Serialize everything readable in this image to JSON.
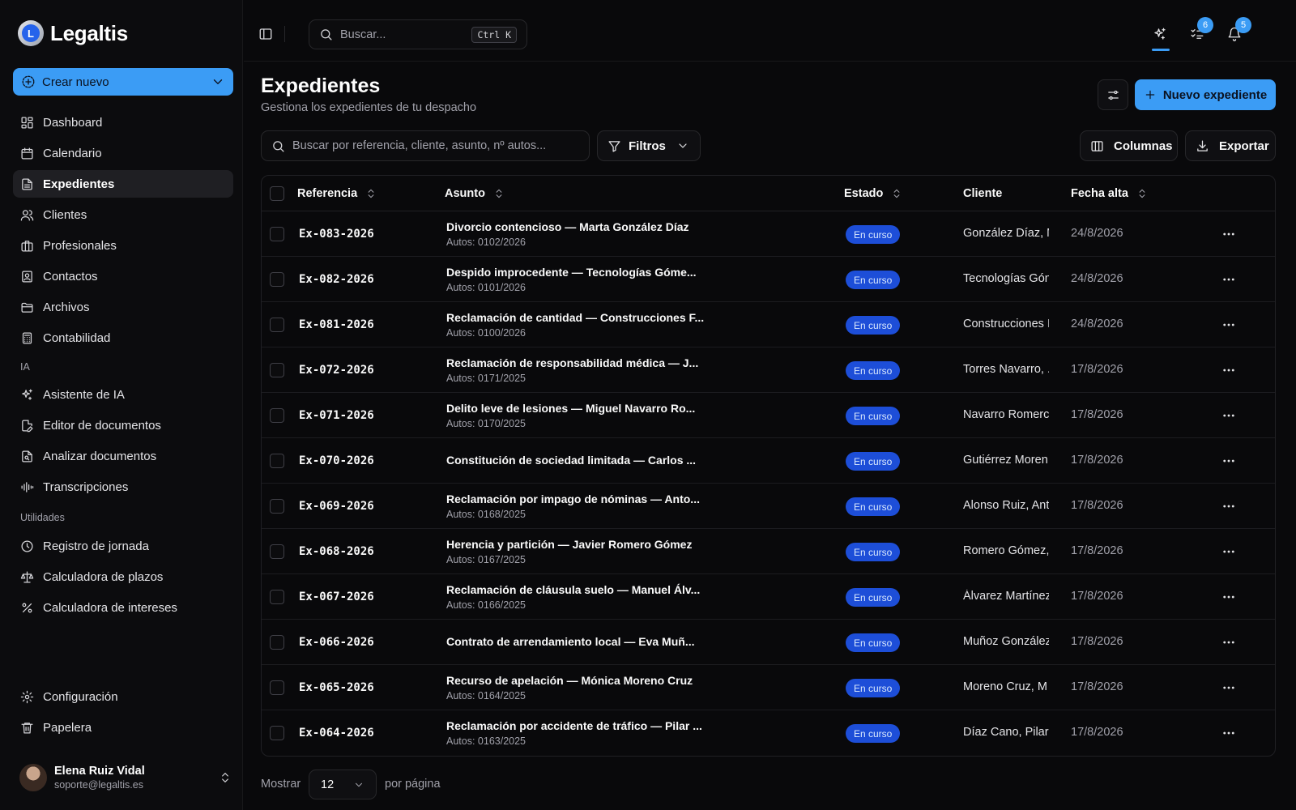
{
  "brand": {
    "name": "Legaltis",
    "mark": "L"
  },
  "sidebar": {
    "create_label": "Crear nuevo",
    "main_items": [
      {
        "label": "Dashboard",
        "icon": "dashboard-icon"
      },
      {
        "label": "Calendario",
        "icon": "calendar-icon"
      },
      {
        "label": "Expedientes",
        "icon": "file-icon",
        "active": true
      },
      {
        "label": "Clientes",
        "icon": "users-icon"
      },
      {
        "label": "Profesionales",
        "icon": "briefcase-icon"
      },
      {
        "label": "Contactos",
        "icon": "contact-icon"
      },
      {
        "label": "Archivos",
        "icon": "folder-icon"
      },
      {
        "label": "Contabilidad",
        "icon": "calculator-icon"
      }
    ],
    "ia_label": "IA",
    "ia_items": [
      {
        "label": "Asistente de IA",
        "icon": "sparkles-icon"
      },
      {
        "label": "Editor de documentos",
        "icon": "file-edit-icon"
      },
      {
        "label": "Analizar documentos",
        "icon": "file-search-icon"
      },
      {
        "label": "Transcripciones",
        "icon": "audio-wave-icon"
      }
    ],
    "util_label": "Utilidades",
    "util_items": [
      {
        "label": "Registro de jornada",
        "icon": "clock-icon"
      },
      {
        "label": "Calculadora de plazos",
        "icon": "scale-icon"
      },
      {
        "label": "Calculadora de intereses",
        "icon": "percent-icon"
      }
    ],
    "bottom_items": [
      {
        "label": "Configuración",
        "icon": "gear-icon"
      },
      {
        "label": "Papelera",
        "icon": "trash-icon"
      }
    ],
    "user": {
      "name": "Elena Ruiz Vidal",
      "email": "soporte@legaltis.es"
    }
  },
  "topbar": {
    "search_placeholder": "Buscar...",
    "shortcut": "Ctrl K",
    "tasks_badge": "6",
    "notifications_badge": "5"
  },
  "page": {
    "title": "Expedientes",
    "subtitle": "Gestiona los expedientes de tu despacho",
    "new_label": "Nuevo expediente",
    "search_placeholder": "Buscar por referencia, cliente, asunto, nº autos...",
    "filters_label": "Filtros",
    "columns_label": "Columnas",
    "export_label": "Exportar"
  },
  "table": {
    "headers": {
      "ref": "Referencia",
      "subject": "Asunto",
      "status": "Estado",
      "client": "Cliente",
      "date": "Fecha alta"
    },
    "rows": [
      {
        "ref": "Ex-083-2026",
        "subject": "Divorcio contencioso — Marta González Díaz",
        "autos": "Autos: 0102/2026",
        "status": "En curso",
        "client": "González Díaz, M",
        "date": "24/8/2026"
      },
      {
        "ref": "Ex-082-2026",
        "subject": "Despido improcedente — Tecnologías Góme...",
        "autos": "Autos: 0101/2026",
        "status": "En curso",
        "client": "Tecnologías Gón",
        "date": "24/8/2026"
      },
      {
        "ref": "Ex-081-2026",
        "subject": "Reclamación de cantidad — Construcciones F...",
        "autos": "Autos: 0100/2026",
        "status": "En curso",
        "client": "Construcciones I",
        "date": "24/8/2026"
      },
      {
        "ref": "Ex-072-2026",
        "subject": "Reclamación de responsabilidad médica — J...",
        "autos": "Autos: 0171/2025",
        "status": "En curso",
        "client": "Torres Navarro, .",
        "date": "17/8/2026"
      },
      {
        "ref": "Ex-071-2026",
        "subject": "Delito leve de lesiones — Miguel Navarro Ro...",
        "autos": "Autos: 0170/2025",
        "status": "En curso",
        "client": "Navarro Romerc",
        "date": "17/8/2026"
      },
      {
        "ref": "Ex-070-2026",
        "subject": "Constitución de sociedad limitada — Carlos ...",
        "autos": "",
        "status": "En curso",
        "client": "Gutiérrez Moren",
        "date": "17/8/2026"
      },
      {
        "ref": "Ex-069-2026",
        "subject": "Reclamación por impago de nóminas — Anto...",
        "autos": "Autos: 0168/2025",
        "status": "En curso",
        "client": "Alonso Ruiz, Ant",
        "date": "17/8/2026"
      },
      {
        "ref": "Ex-068-2026",
        "subject": "Herencia y partición — Javier Romero Gómez",
        "autos": "Autos: 0167/2025",
        "status": "En curso",
        "client": "Romero Gómez,",
        "date": "17/8/2026"
      },
      {
        "ref": "Ex-067-2026",
        "subject": "Reclamación de cláusula suelo — Manuel Álv...",
        "autos": "Autos: 0166/2025",
        "status": "En curso",
        "client": "Álvarez Martínez",
        "date": "17/8/2026"
      },
      {
        "ref": "Ex-066-2026",
        "subject": "Contrato de arrendamiento local — Eva Muñ...",
        "autos": "",
        "status": "En curso",
        "client": "Muñoz González",
        "date": "17/8/2026"
      },
      {
        "ref": "Ex-065-2026",
        "subject": "Recurso de apelación — Mónica Moreno Cruz",
        "autos": "Autos: 0164/2025",
        "status": "En curso",
        "client": "Moreno Cruz, M",
        "date": "17/8/2026"
      },
      {
        "ref": "Ex-064-2026",
        "subject": "Reclamación por accidente de tráfico — Pilar ...",
        "autos": "Autos: 0163/2025",
        "status": "En curso",
        "client": "Díaz Cano, Pilar",
        "date": "17/8/2026"
      }
    ]
  },
  "footer": {
    "show_label": "Mostrar",
    "page_size": "12",
    "per_page_label": "por página"
  },
  "colors": {
    "accent": "#3b9cf5",
    "status_badge": "#1d4ed8",
    "background": "#09090b"
  }
}
